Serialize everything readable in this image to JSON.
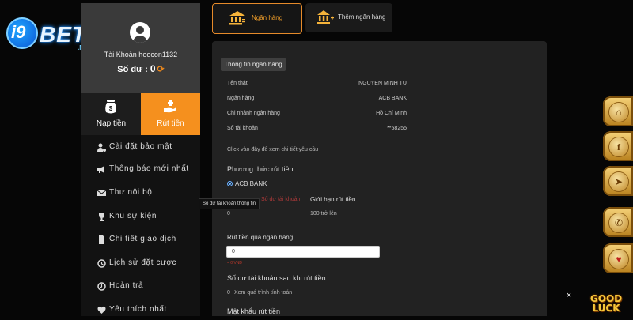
{
  "brand": {
    "logo_main": "i9",
    "logo_bet": "BET",
    "logo_suffix": ".MN"
  },
  "user": {
    "account_label": "Tài Khoản heocon1132",
    "balance_label": "Số dư :",
    "balance_value": "0"
  },
  "actions": {
    "deposit_label": "Nạp tiền",
    "withdraw_label": "Rút tiền"
  },
  "menu": {
    "items": [
      {
        "label": "Cài đặt bảo mật",
        "icon": "user-gear-icon"
      },
      {
        "label": "Thông báo mới nhất",
        "icon": "megaphone-icon"
      },
      {
        "label": "Thư nội bộ",
        "icon": "envelope-icon"
      },
      {
        "label": "Khu sự kiện",
        "icon": "trophy-icon"
      },
      {
        "label": "Chi tiết giao dịch",
        "icon": "document-icon"
      },
      {
        "label": "Lịch sử đặt cược",
        "icon": "history-icon"
      },
      {
        "label": "Hoàn trả",
        "icon": "refund-icon"
      },
      {
        "label": "Yêu thích nhất",
        "icon": "heart-icon"
      }
    ]
  },
  "tabs": {
    "bank": "Ngân hàng",
    "add_bank": "Thêm ngân hàng"
  },
  "bank_info": {
    "header": "Thông tin ngân hàng",
    "rows": [
      {
        "label": "Tên thật",
        "value": "NGUYEN MINH TU"
      },
      {
        "label": "Ngân hàng",
        "value": "ACB BANK"
      },
      {
        "label": "Chi nhánh ngân hàng",
        "value": "Hồ Chí Minh"
      },
      {
        "label": "Số tài khoản",
        "value": "**58255"
      }
    ],
    "details_hint": "Click vào đây để xem chi tiết yêu cầu"
  },
  "withdraw": {
    "method_title": "Phương thức rút tiền",
    "method_option": "ACB BANK",
    "col1_label": "Số dư tài khoản",
    "col1_value": "0",
    "col2_label": "Giới hạn rút tiền",
    "col2_value": "100 trở lên",
    "bank_withdraw_title": "Rút tiền qua ngân hàng",
    "amount_value": "0",
    "amount_hint": "= 0 VND",
    "after_balance_title": "Số dư tài khoản sau khi rút tiền",
    "after_balance_value": "0",
    "after_balance_hint": "Xem quá trình tính toán",
    "password_title": "Mật khẩu rút tiền"
  },
  "tooltip": {
    "text": "Số dư tài khoản thông tin"
  },
  "floating": {
    "close": "×",
    "good_luck": "GOOD LUCK"
  },
  "colors": {
    "accent": "#f5901e",
    "panel": "#222222",
    "sidebar": "#121212"
  }
}
